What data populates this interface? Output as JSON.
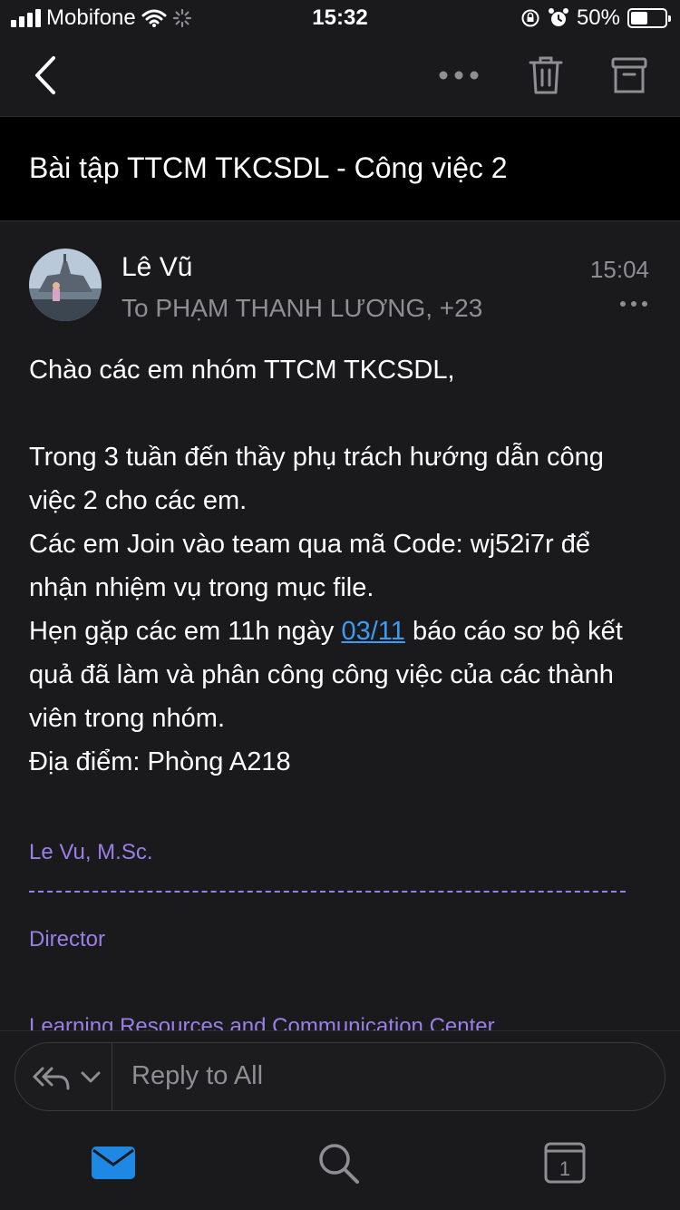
{
  "status_bar": {
    "carrier": "Mobifone",
    "time": "15:32",
    "battery": "50%",
    "battery_level": 0.5
  },
  "toolbar": {
    "back_icon": "chevron-left-icon",
    "more_icon": "more-dots-icon",
    "delete_icon": "trash-icon",
    "archive_icon": "archive-icon"
  },
  "email": {
    "subject": "Bài tập TTCM TKCSDL - Công việc 2",
    "sender": "Lê Vũ",
    "recipients": "To PHẠM THANH LƯƠNG, +23",
    "time": "15:04",
    "greeting": "Chào các em nhóm TTCM TKCSDL,",
    "line1": "Trong 3 tuần đến thầy phụ trách hướng dẫn công việc 2 cho các em.",
    "line2": "Các em Join vào team qua mã Code: wj52i7r để nhận nhiệm vụ trong mục file.",
    "line3_before": "Hẹn gặp các em 11h ngày ",
    "line3_link": "03/11",
    "line3_after": " báo cáo sơ bộ kết quả đã làm và phân công công việc của các thành viên trong nhóm.",
    "line4": "Địa điểm: Phòng A218",
    "signature_name": "Le Vu, M.Sc.",
    "signature_title": "Director",
    "signature_org": "Learning Resources and Communication Center"
  },
  "reply": {
    "placeholder": "Reply to All"
  },
  "tab_bar": {
    "mail_icon": "mail-icon",
    "search_icon": "search-icon",
    "calendar_icon": "calendar-icon",
    "calendar_day": "1"
  },
  "colors": {
    "background": "#1a1a1c",
    "link": "#3d9bf4",
    "signature": "#9b7fe8",
    "accent": "#1e88e5"
  }
}
